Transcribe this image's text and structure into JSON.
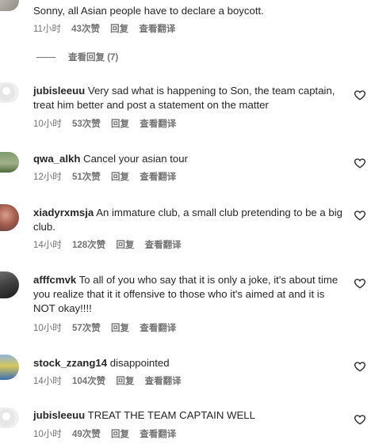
{
  "comments": [
    {
      "username": "",
      "text": "Sonny, all Asian people have to declare a boycott.",
      "time": "11小时",
      "likes": "43次赞",
      "reply": "回复",
      "translate": "查看翻译"
    },
    {
      "username": "jubisleeuu",
      "text": "Very sad what is happening to Son, the team captain, treat him better and post a statement on the matter",
      "time": "10小时",
      "likes": "53次赞",
      "reply": "回复",
      "translate": "查看翻译"
    },
    {
      "username": "qwa_alkh",
      "text": "Cancel your asian tour",
      "time": "12小时",
      "likes": "51次赞",
      "reply": "回复",
      "translate": "查看翻译"
    },
    {
      "username": "xiadyrxmsja",
      "text": "An immature club, a small club pretending to be a big club.",
      "time": "14小时",
      "likes": "128次赞",
      "reply": "回复",
      "translate": "查看翻译"
    },
    {
      "username": "afffcmvk",
      "text": "To all of you who say that it is only a joke, it's about time you realize that it it offensive to those who it's aimed at and it is NOT okay!!!!",
      "time": "10小时",
      "likes": "57次赞",
      "reply": "回复",
      "translate": "查看翻译"
    },
    {
      "username": "stock_zzang14",
      "text": "disappointed",
      "time": "14小时",
      "likes": "104次赞",
      "reply": "回复",
      "translate": "查看翻译"
    },
    {
      "username": "jubisleeuu",
      "text": "TREAT THE TEAM CAPTAIN WELL",
      "time": "10小时",
      "likes": "49次赞",
      "reply": "回复",
      "translate": "查看翻译"
    }
  ],
  "view_replies": "查看回复 (7)"
}
